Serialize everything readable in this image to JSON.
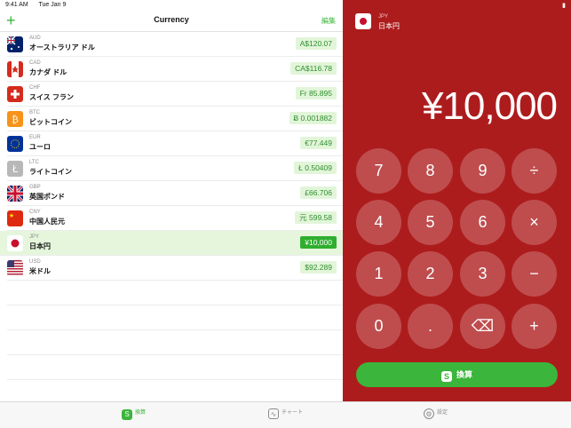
{
  "status": {
    "time": "9:41 AM",
    "date": "Tue Jan 9"
  },
  "nav": {
    "add": "+",
    "title": "Currency",
    "edit": "編集"
  },
  "currencies": [
    {
      "code": "AUD",
      "name": "オーストラリア ドル",
      "value": "A$120.07",
      "flag": "flag-australia"
    },
    {
      "code": "CAD",
      "name": "カナダ ドル",
      "value": "CA$116.78",
      "flag": "flag-canada"
    },
    {
      "code": "CHF",
      "name": "スイス フラン",
      "value": "Fr 85.895",
      "flag": "flag-switzerland"
    },
    {
      "code": "BTC",
      "name": "ビットコイン",
      "value": "Ƀ 0.001882",
      "flag": "bitcoin-icon"
    },
    {
      "code": "EUR",
      "name": "ユーロ",
      "value": "€77.449",
      "flag": "flag-eu"
    },
    {
      "code": "LTC",
      "name": "ライトコイン",
      "value": "Ł 0.50409",
      "flag": "litecoin-icon"
    },
    {
      "code": "GBP",
      "name": "英国ポンド",
      "value": "£66.706",
      "flag": "flag-uk"
    },
    {
      "code": "CNY",
      "name": "中国人民元",
      "value": "元 599.58",
      "flag": "flag-china"
    },
    {
      "code": "JPY",
      "name": "日本円",
      "value": "¥10,000",
      "flag": "flag-japan",
      "selected": true
    },
    {
      "code": "USD",
      "name": "米ドル",
      "value": "$92.289",
      "flag": "flag-usa"
    }
  ],
  "selected": {
    "code": "JPY",
    "name": "日本円",
    "amount": "¥10,000"
  },
  "keys": [
    "7",
    "8",
    "9",
    "÷",
    "4",
    "5",
    "6",
    "×",
    "1",
    "2",
    "3",
    "−",
    "0",
    ".",
    "⌫",
    "+"
  ],
  "convert_label": "換算",
  "tabs": {
    "convert": "換算",
    "chart": "チャート",
    "settings": "設定"
  },
  "colors": {
    "accent": "#3bb53b",
    "panel": "#ad1c1d"
  }
}
